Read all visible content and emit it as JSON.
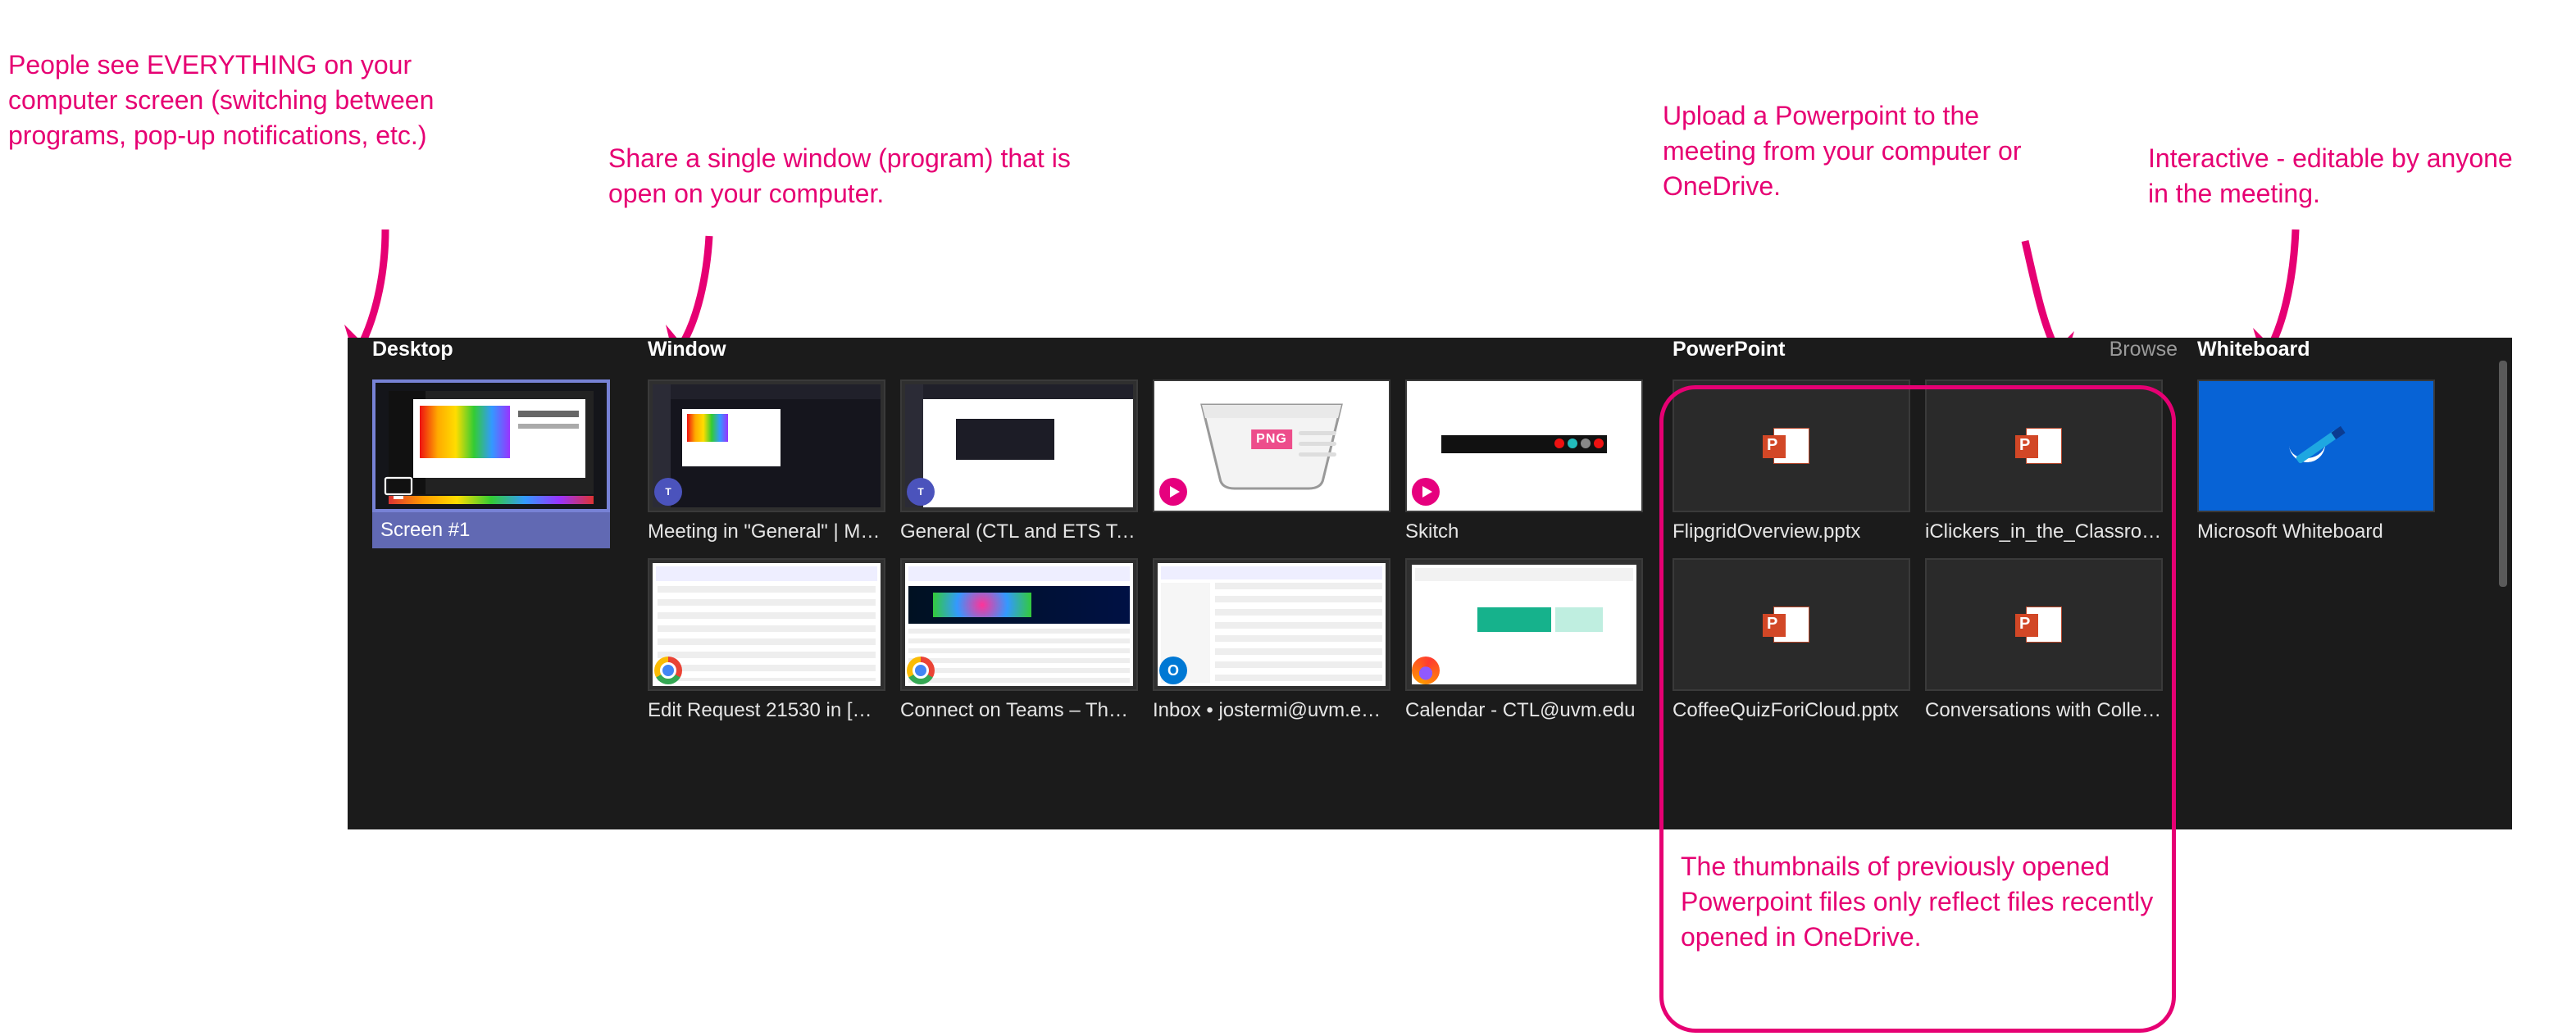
{
  "annotations": {
    "desktop": "People see EVERYTHING on your computer screen (switching between programs, pop-up notifications, etc.)",
    "window": "Share a single window (program) that is open on your computer.",
    "powerpoint": "Upload a Powerpoint to the meeting from your computer or OneDrive.",
    "whiteboard": "Interactive - editable by anyone in the meeting.",
    "ppt_note": "The thumbnails of previously opened Powerpoint files only reflect files recently opened in OneDrive."
  },
  "tray": {
    "sections": {
      "desktop": {
        "title": "Desktop"
      },
      "window": {
        "title": "Window"
      },
      "powerpoint": {
        "title": "PowerPoint",
        "browse": "Browse"
      },
      "whiteboard": {
        "title": "Whiteboard"
      }
    },
    "desktop_tile": {
      "label": "Screen #1"
    },
    "windows": [
      {
        "label": "Meeting in \"General\" | M…",
        "kind": "teams-dark"
      },
      {
        "label": "General (CTL and ETS Te…",
        "kind": "teams-light"
      },
      {
        "label": "",
        "kind": "skitch-tray"
      },
      {
        "label": "Skitch",
        "kind": "skitch-shot"
      },
      {
        "label": "Edit Request 21530 in [D…",
        "kind": "chrome"
      },
      {
        "label": "Connect on Teams – The…",
        "kind": "chrome-color"
      },
      {
        "label": "Inbox • jostermi@uvm.e…",
        "kind": "outlook"
      },
      {
        "label": "Calendar - CTL@uvm.edu",
        "kind": "firefox-cal"
      }
    ],
    "powerpoints": [
      {
        "label": "FlipgridOverview.pptx"
      },
      {
        "label": "iClickers_in_the_Classroo…"
      },
      {
        "label": "CoffeeQuizForiCloud.pptx"
      },
      {
        "label": "Conversations with Colle…"
      }
    ],
    "whiteboard_tile": {
      "label": "Microsoft Whiteboard"
    }
  }
}
